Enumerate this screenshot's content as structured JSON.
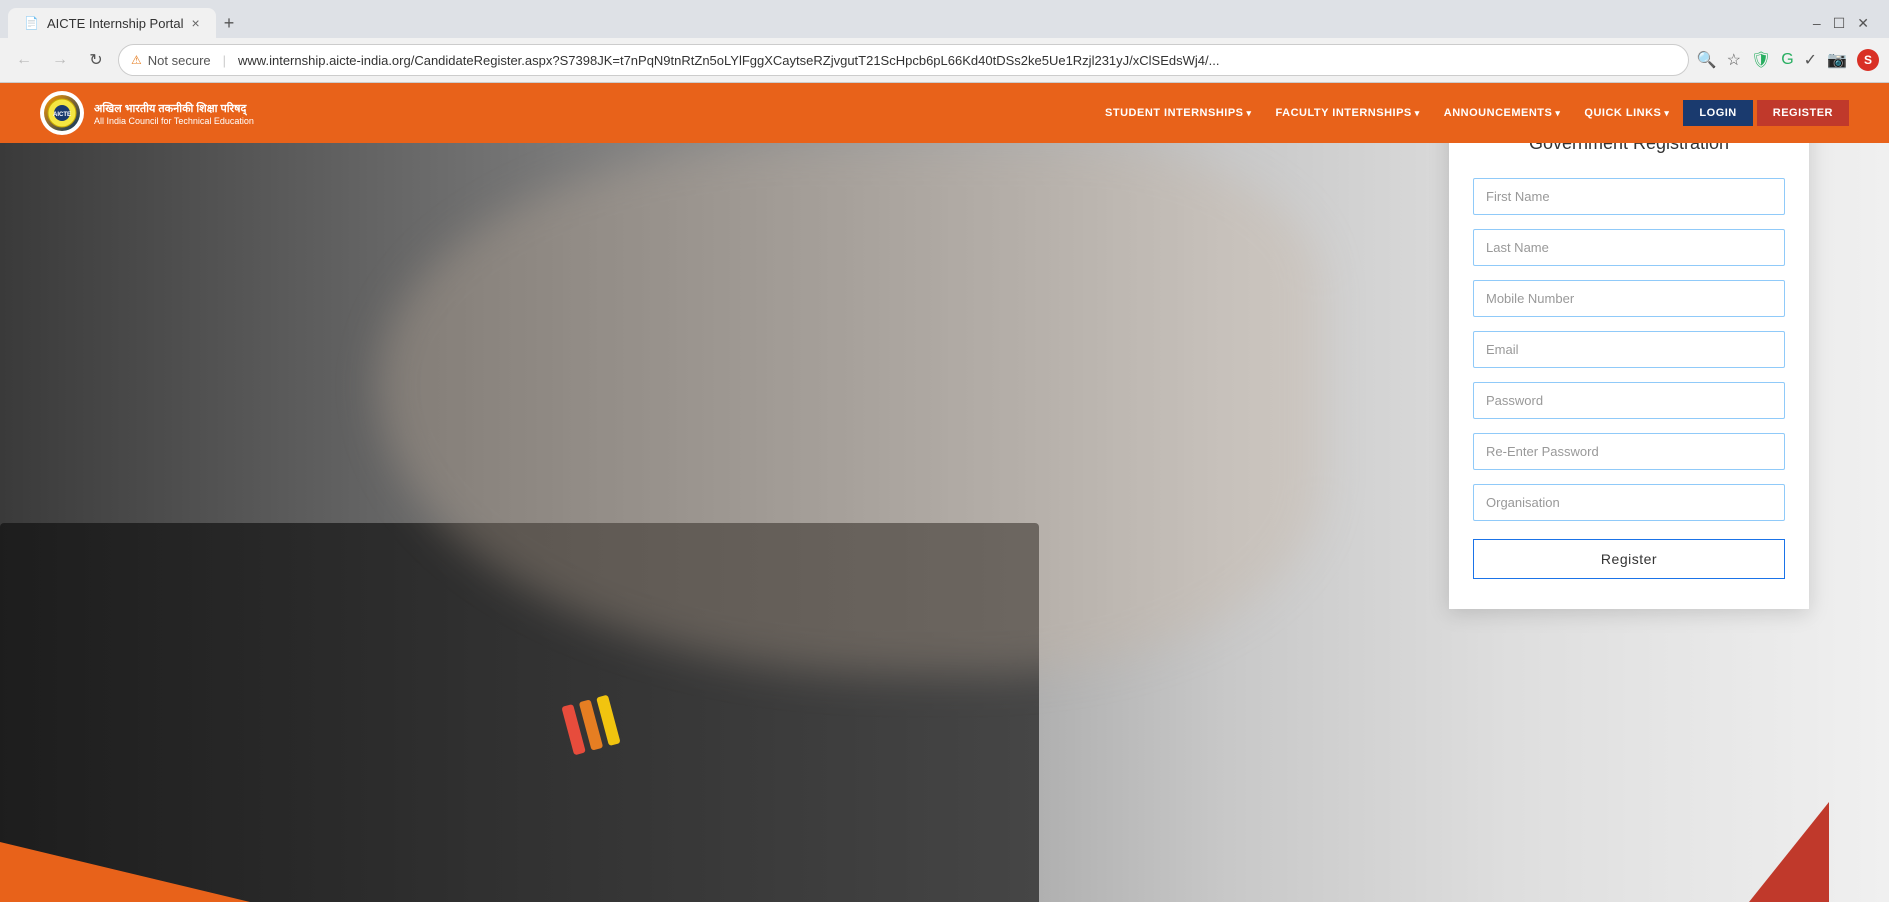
{
  "browser": {
    "tab_title": "AICTE Internship Portal",
    "new_tab_label": "+",
    "close_label": "×",
    "back_label": "←",
    "forward_label": "→",
    "refresh_label": "↻",
    "security_label": "Not secure",
    "url": "www.internship.aicte-india.org/CandidateRegister.aspx?S7398JK=t7nPqN9tnRtZn5oLYlFggXCaytseRZjvgutT21ScHpcb6pL66Kd40tDSs2ke5Ue1Rzjl231yJ/xClSEdsWj4/...",
    "minimize_label": "–",
    "maximize_label": "☐",
    "close_win_label": "✕"
  },
  "navbar": {
    "logo_hindi": "अखिल भारतीय तकनीकी शिक्षा परिषद्",
    "logo_english": "All India Council for Technical Education",
    "nav_items": [
      {
        "label": "STUDENT INTERNSHIPS",
        "has_dropdown": true
      },
      {
        "label": "FACULTY INTERNSHIPS",
        "has_dropdown": true
      },
      {
        "label": "ANNOUNCEMENTS",
        "has_dropdown": true
      },
      {
        "label": "QUICK LINKS",
        "has_dropdown": true
      }
    ],
    "login_label": "LOGIN",
    "register_label": "REGISTER"
  },
  "registration": {
    "title": "Government Registration",
    "fields": [
      {
        "placeholder": "First Name",
        "type": "text",
        "name": "first-name"
      },
      {
        "placeholder": "Last Name",
        "type": "text",
        "name": "last-name"
      },
      {
        "placeholder": "Mobile Number",
        "type": "tel",
        "name": "mobile-number"
      },
      {
        "placeholder": "Email",
        "type": "email",
        "name": "email"
      },
      {
        "placeholder": "Password",
        "type": "password",
        "name": "password"
      },
      {
        "placeholder": "Re-Enter Password",
        "type": "password",
        "name": "re-enter-password"
      },
      {
        "placeholder": "Organisation",
        "type": "text",
        "name": "organisation"
      }
    ],
    "submit_label": "Register"
  }
}
